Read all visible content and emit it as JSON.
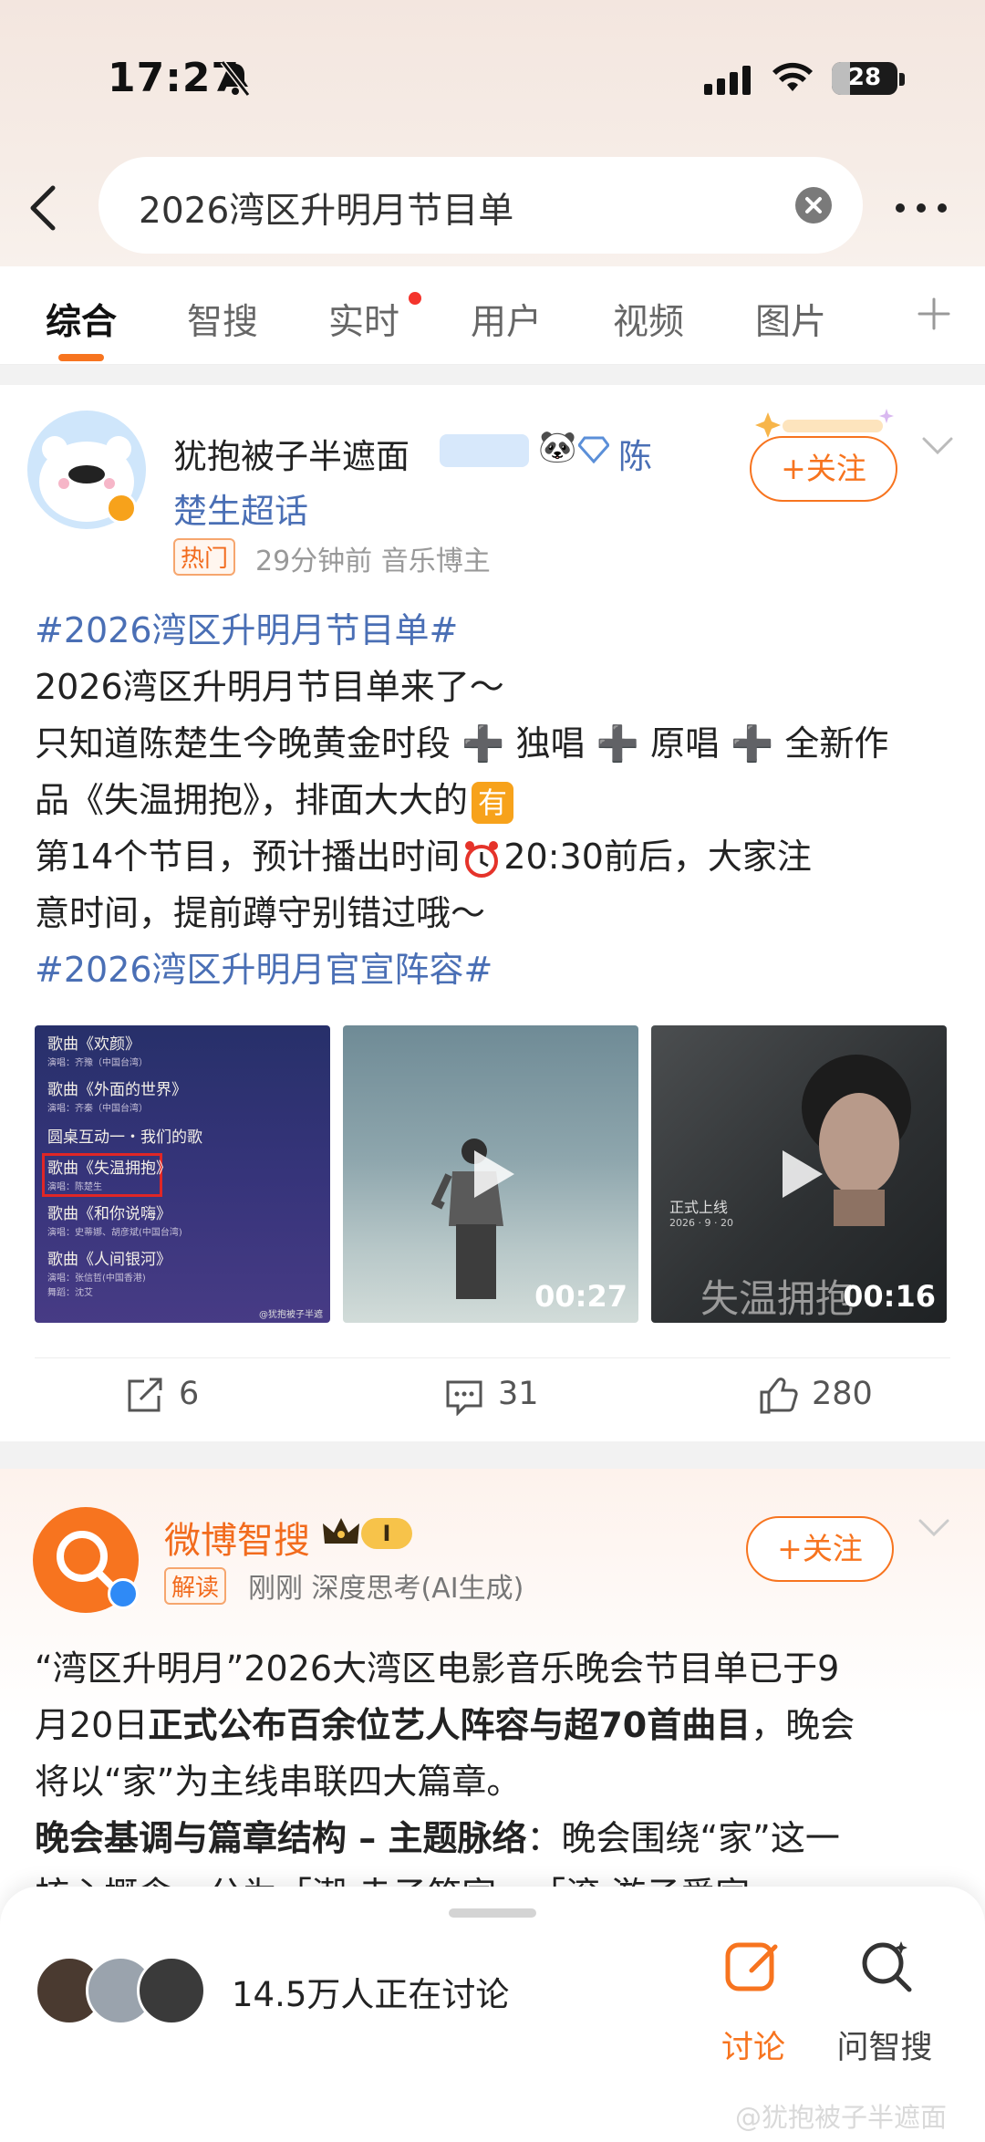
{
  "status_bar": {
    "time": "17:27",
    "battery": "28",
    "battery_fraction": 0.28
  },
  "search": {
    "query": "2026湾区升明月节目单"
  },
  "tabs": [
    {
      "label": "综合",
      "active": true
    },
    {
      "label": "智搜"
    },
    {
      "label": "实时",
      "dot": true
    },
    {
      "label": "用户"
    },
    {
      "label": "视频"
    },
    {
      "label": "图片"
    }
  ],
  "post1": {
    "user_name": "犹抱被子半遮面",
    "super_topic": "陈",
    "super_topic2": "楚生超话",
    "hot_badge": "热门",
    "meta": "29分钟前  音乐博主",
    "follow_label": "+关注",
    "tag1": "#2026湾区升明月节目单#",
    "line1": "2026湾区升明月节目单来了～",
    "line2": "只知道陈楚生今晚黄金时段 ➕ 独唱 ➕ 原唱 ➕ 全新作",
    "line3": "品《失温拥抱》，排面大大的",
    "emoji_you": "有",
    "line4": "第14个节目，预计播出时间",
    "line4b": "20:30前后，大家注",
    "line5": "意时间，提前蹲守别错过哦～",
    "tag2": "#2026湾区升明月官宣阵容#",
    "image_list": {
      "items": [
        {
          "title": "歌曲《欢颜》",
          "sub": "演唱：齐豫（中国台湾）"
        },
        {
          "title": "歌曲《外面的世界》",
          "sub": "演唱：齐秦（中国台湾）"
        },
        {
          "title": "圆桌互动一・我们的歌",
          "sub": ""
        },
        {
          "title": "歌曲《失温拥抱》",
          "sub": "演唱：陈楚生"
        },
        {
          "title": "歌曲《和你说嗨》",
          "sub": "演唱：史蒂娜、胡彦斌(中国台湾)"
        },
        {
          "title": "歌曲《人间银河》",
          "sub": "演唱：张信哲(中国香港)"
        }
      ],
      "footer": "舞蹈：沈艾",
      "watermark": "@犹抱被子半遮面"
    },
    "video1_duration": "00:27",
    "video2_duration": "00:16",
    "video2_caption": "正式上线",
    "video2_date": "2026 · 9 · 20",
    "video2_title": "失温拥抱",
    "repost_count": "6",
    "comment_count": "31",
    "like_count": "280"
  },
  "post2": {
    "user_name": "微博智搜",
    "level_badge": "I",
    "tag_badge": "解读",
    "meta": "刚刚  深度思考(AI生成)",
    "follow_label": "+关注",
    "p1a": "“湾区升明月”2026大湾区电影音乐晚会节目单已于9",
    "p1b_pre": "月20日",
    "p1b_bold": "正式公布百余位艺人阵容与超70首曲目",
    "p1b_post": "，晚会",
    "p1c": "将以“家”为主线串联四大篇章。",
    "p2_bold": "晚会基调与篇章结构 – 主题脉络",
    "p2_post": "：晚会围绕“家”这一",
    "p3": "核心概念，分为「潮·赤子筑家」、「滚·游子爱家」、"
  },
  "bottom_sheet": {
    "discussion": "14.5万人正在讨论",
    "btn_discuss": "讨论",
    "btn_ask": "问智搜"
  },
  "watermark": "@犹抱被子半遮面",
  "colors": {
    "accent": "#f7741f",
    "link": "#4a6fb5",
    "hot": "#f26b1d"
  }
}
